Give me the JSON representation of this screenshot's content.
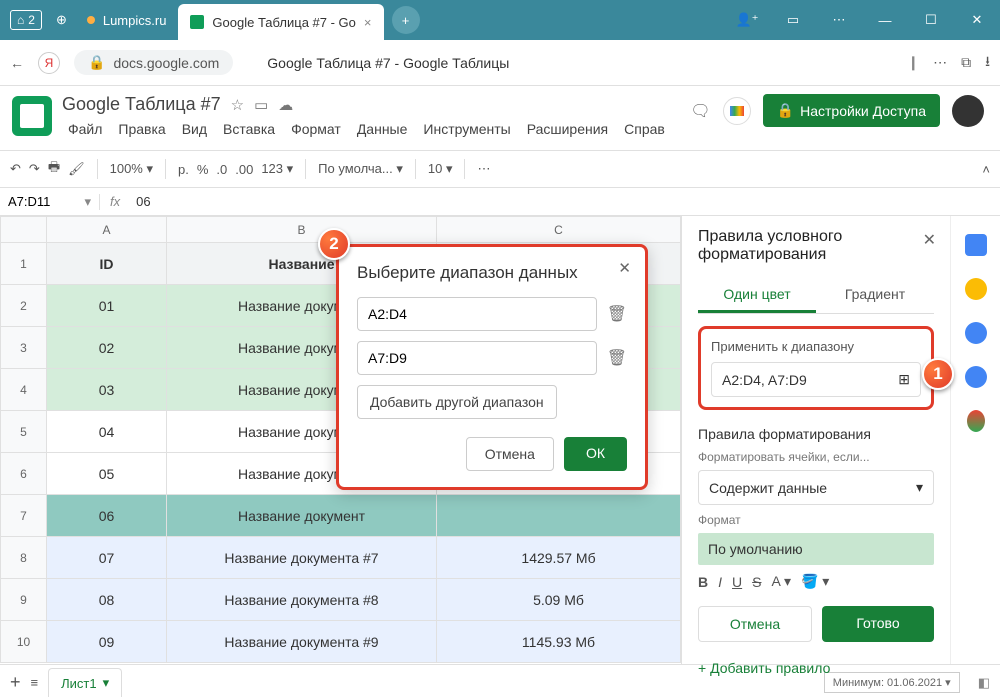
{
  "window": {
    "home_num": "2",
    "tab1": "Lumpics.ru",
    "tab2": "Google Таблица #7 - Go",
    "tab2_close": "×"
  },
  "addr": {
    "url": "docs.google.com",
    "title": "Google Таблица #7 - Google Таблицы"
  },
  "docs": {
    "title": "Google Таблица #7",
    "menu": [
      "Файл",
      "Правка",
      "Вид",
      "Вставка",
      "Формат",
      "Данные",
      "Инструменты",
      "Расширения",
      "Справ"
    ],
    "share": "Настройки Доступа"
  },
  "toolbar": {
    "zoom": "100%",
    "currency": "р.",
    "pct": "%",
    "dec0": ".0",
    "dec00": ".00",
    "fmt123": "123",
    "font": "По умолча...",
    "size": "10"
  },
  "namebox": {
    "ref": "A7:D11",
    "fx": "06"
  },
  "columns": [
    "A",
    "B",
    "C"
  ],
  "header_row": {
    "A": "ID",
    "B": "Название"
  },
  "rows": [
    {
      "n": "1",
      "A": "ID",
      "B": "Название",
      "C": "",
      "cls": "hdrcell"
    },
    {
      "n": "2",
      "A": "01",
      "B": "Название документ",
      "C": "",
      "cls": "green"
    },
    {
      "n": "3",
      "A": "02",
      "B": "Название документ",
      "C": "",
      "cls": "green"
    },
    {
      "n": "4",
      "A": "03",
      "B": "Название документ",
      "C": "",
      "cls": "green"
    },
    {
      "n": "5",
      "A": "04",
      "B": "Название документ",
      "C": "",
      "cls": ""
    },
    {
      "n": "6",
      "A": "05",
      "B": "Название документ",
      "C": "",
      "cls": ""
    },
    {
      "n": "7",
      "A": "06",
      "B": "Название документ",
      "C": "",
      "cls": "teal"
    },
    {
      "n": "8",
      "A": "07",
      "B": "Название документа #7",
      "C": "1429.57 Мб",
      "cls": "blue-sel"
    },
    {
      "n": "9",
      "A": "08",
      "B": "Название документа #8",
      "C": "5.09 Мб",
      "cls": "blue-sel"
    },
    {
      "n": "10",
      "A": "09",
      "B": "Название документа #9",
      "C": "1145.93 Мб",
      "cls": "blue-sel"
    }
  ],
  "panel": {
    "title": "Правила условного форматирования",
    "tab_single": "Один цвет",
    "tab_gradient": "Градиент",
    "apply_label": "Применить к диапазону",
    "range": "A2:D4, A7:D9",
    "rules_label": "Правила форматирования",
    "cond_label": "Форматировать ячейки, если...",
    "cond_value": "Содержит данные",
    "format_label": "Формат",
    "format_preview": "По умолчанию",
    "cancel": "Отмена",
    "done": "Готово",
    "add_rule": "+  Добавить правило"
  },
  "dialog": {
    "title": "Выберите диапазон данных",
    "r1": "A2:D4",
    "r2": "A7:D9",
    "add": "Добавить другой диапазон",
    "cancel": "Отмена",
    "ok": "ОК"
  },
  "sheetbar": {
    "tab": "Лист1",
    "min": "Минимум: 01.06.2021"
  },
  "badges": {
    "b1": "1",
    "b2": "2"
  }
}
